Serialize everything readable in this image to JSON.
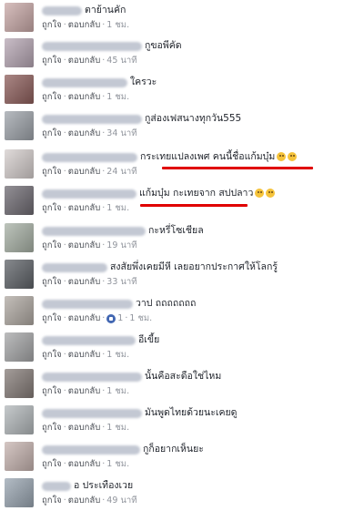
{
  "actions": {
    "like": "ถูกใจ",
    "reply": "ตอบกลับ",
    "dot": "·"
  },
  "colors": {
    "link": "#4b4f56",
    "meta": "#90949c",
    "highlight": "#e00000",
    "reaction": "#4267b2"
  },
  "comments": [
    {
      "text": "ตาย้านคัก",
      "time": "1 ชม."
    },
    {
      "text": "กูขอพีคัด",
      "time": "45 นาที"
    },
    {
      "text": "ใครวะ",
      "time": "1 ชม."
    },
    {
      "text": "กูส่องเฟสนางทุกวัน555",
      "time": "34 นาที"
    },
    {
      "text": "กระเทยแปลงเพศ คนนี้ชื่อแก้มบุ๋ม",
      "time": "24 นาที",
      "emoji": "grinning-emoji"
    },
    {
      "text": "แก้มบุ๋ม กะเทยจาก สปปลาว",
      "time": "1 ชม.",
      "emoji": "laughing-emoji"
    },
    {
      "text": "กะหรี่โซเชียล",
      "time": "19 นาที"
    },
    {
      "text": "สงสัยพึ่งเคยมีหี เลยอยากประกาศให้โลกรู้",
      "time": "33 นาที"
    },
    {
      "text": "วาป ถถถถถถถ",
      "time": "1 ชม.",
      "reaction_count": "1"
    },
    {
      "text": "อีเขี้ย",
      "time": "1 ชม."
    },
    {
      "text": "นั้นคือสะดือใช่ไหม",
      "time": "1 ชม."
    },
    {
      "text": "มันพูดไทยด้วยนะเคยดู",
      "time": "1 ชม."
    },
    {
      "text": "กูก็อยากเห็นยะ",
      "time": "1 ชม."
    },
    {
      "text": "อ ประเทืองเวย",
      "time": "49 นาที"
    }
  ]
}
